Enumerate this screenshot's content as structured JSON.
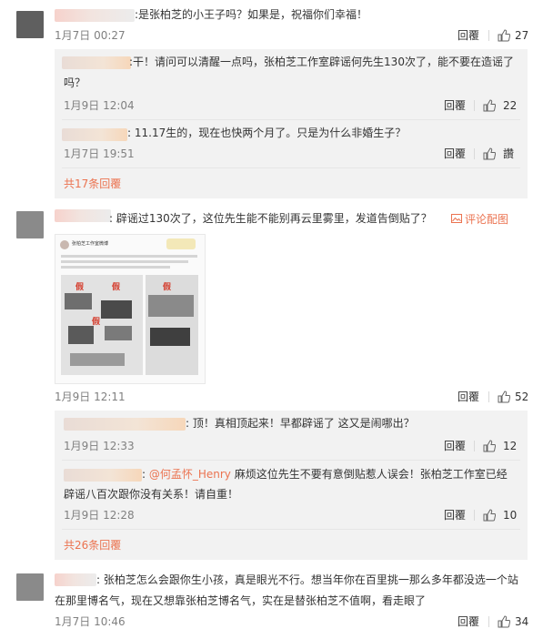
{
  "c1": {
    "text": ":是张柏芝的小王子吗？如果是，祝福你们幸福！",
    "time": "1月7日 00:27",
    "reply": "回覆",
    "likes": "27"
  },
  "c1r1": {
    "text_line1": ":干！请问可以清醒一点吗，张柏芝工作室辟谣何先生130次了，能不要在造谣了",
    "text_line2": "吗？",
    "time": "1月9日 12:04",
    "reply": "回覆",
    "likes": "22"
  },
  "c1r2": {
    "text": ": 11.17生的，现在也快两个月了。只是为什么非婚生子？",
    "time": "1月7日 19:51",
    "reply": "回覆",
    "likes": "讚"
  },
  "c1_more": "共17条回覆",
  "c2": {
    "text": ": 辟谣过130次了，这位先生能不能别再云里雾里，发道告倒贴了？",
    "pic_action": "评论配图",
    "time": "1月9日 12:11",
    "reply": "回覆",
    "likes": "52",
    "post_account": "张柏芝工作室微博",
    "stamp_chars": [
      "假",
      "假",
      "假",
      "假"
    ]
  },
  "c2r1": {
    "text": ": 顶！真相顶起来！早都辟谣了 这又是闹哪出？",
    "time": "1月9日 12:33",
    "reply": "回覆",
    "likes": "12"
  },
  "c2r2": {
    "mention": "@何孟怀_Henry",
    "text_line1": " 麻烦这位先生不要有意倒贴惹人误会！张柏芝工作室已经",
    "text_line2": "辟谣八百次跟你没有关系！请自重！",
    "time": "1月9日 12:28",
    "reply": "回覆",
    "likes": "10"
  },
  "c2_more": "共26条回覆",
  "c3": {
    "text_line1": ": 张柏芝怎么会跟你生小孩，真是眼光不行。想当年你在百里挑一那么多年都没选一个站",
    "text_line2": "在那里博名气，现在又想靠张柏芝博名气，实在是替张柏芝不值啊，看走眼了",
    "time": "1月7日 10:46",
    "reply": "回覆",
    "likes": "34"
  },
  "colors": {
    "accent": "#eb7350",
    "reply_bg": "#f2f2f2",
    "time": "#808080"
  }
}
